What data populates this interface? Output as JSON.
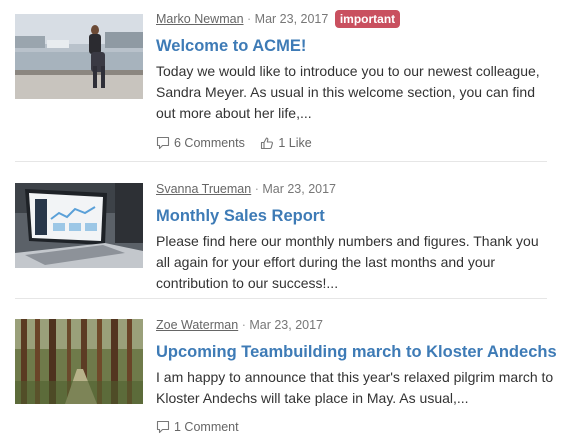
{
  "posts": [
    {
      "author": "Marko Newman",
      "date": "Mar 23, 2017",
      "badge": "important",
      "title": "Welcome to ACME!",
      "excerpt": "Today we would like to introduce you to our newest colleague, Sandra Meyer. As usual in this welcome section, you can find out more about her life,...",
      "comments": "6 Comments",
      "likes": "1 Like",
      "image": "woman-sitting-by-river-photo"
    },
    {
      "author": "Svanna Trueman",
      "date": "Mar 23, 2017",
      "title": "Monthly Sales Report",
      "excerpt": "Please find here our monthly numbers and figures. Thank you all again for your effort during the last months and your contribution to our success!...",
      "image": "laptop-dashboard-photo"
    },
    {
      "author": "Zoe Waterman",
      "date": "Mar 23, 2017",
      "title": "Upcoming Teambuilding march to Kloster Andechs",
      "excerpt": "I am happy to announce that this year's relaxed pilgrim march to Kloster Andechs will take place in May. As usual,...",
      "comments": "1 Comment",
      "image": "forest-path-photo"
    }
  ],
  "meta_separator": "·",
  "colors": {
    "title": "#3e7bb6",
    "badge": "#c9505f",
    "divider": "#e6e6e6"
  }
}
